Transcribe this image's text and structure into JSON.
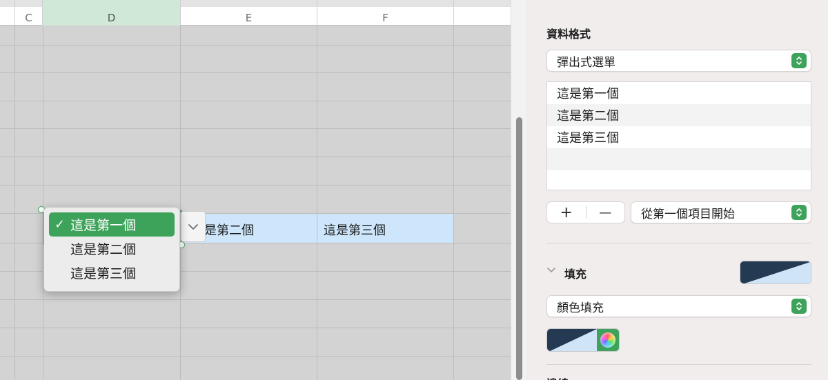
{
  "sheet": {
    "columns": [
      "C",
      "D",
      "E",
      "F"
    ],
    "selected_column": "D",
    "cells": {
      "e_value": "是第二個",
      "f_value": "這是第三個"
    },
    "popup": {
      "items": [
        "這是第一個",
        "這是第二個",
        "這是第三個"
      ],
      "selected_index": 0,
      "check": "✓"
    }
  },
  "sidebar": {
    "data_format_heading": "資料格式",
    "format_select": "彈出式選單",
    "list_items": [
      "這是第一個",
      "這是第二個",
      "這是第三個"
    ],
    "plus_label": "+",
    "minus_label": "—",
    "start_select": "從第一個項目開始",
    "fill_heading": "填充",
    "fill_select": "顏色填充",
    "next_heading": "邊線"
  },
  "colors": {
    "accent_green": "#3ea35a",
    "selection_blue": "#cde6fb",
    "swatch_dark": "#233a52",
    "swatch_light": "#cfe5f7"
  }
}
